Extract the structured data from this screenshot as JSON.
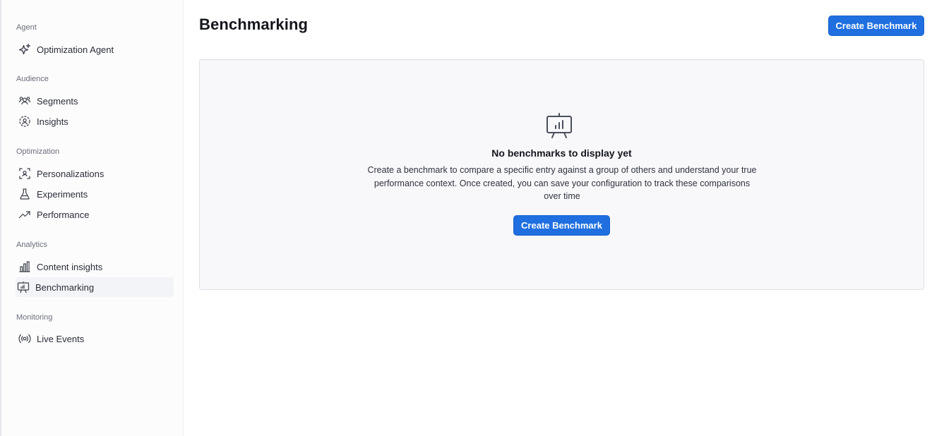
{
  "sidebar": {
    "sections": [
      {
        "label": "Agent",
        "items": [
          {
            "label": "Optimization Agent",
            "icon": "sparkle-icon"
          }
        ]
      },
      {
        "label": "Audience",
        "items": [
          {
            "label": "Segments",
            "icon": "users-icon"
          },
          {
            "label": "Insights",
            "icon": "user-focus-icon"
          }
        ]
      },
      {
        "label": "Optimization",
        "items": [
          {
            "label": "Personalizations",
            "icon": "user-scan-icon"
          },
          {
            "label": "Experiments",
            "icon": "flask-icon"
          },
          {
            "label": "Performance",
            "icon": "trend-up-icon"
          }
        ]
      },
      {
        "label": "Analytics",
        "items": [
          {
            "label": "Content insights",
            "icon": "bar-chart-icon"
          },
          {
            "label": "Benchmarking",
            "icon": "presentation-chart-icon",
            "active": true
          }
        ]
      },
      {
        "label": "Monitoring",
        "items": [
          {
            "label": "Live Events",
            "icon": "broadcast-icon"
          }
        ]
      }
    ]
  },
  "header": {
    "title": "Benchmarking",
    "create_button": "Create Benchmark"
  },
  "empty_state": {
    "icon": "presentation-chart-icon",
    "title": "No benchmarks to display yet",
    "description": "Create a benchmark to compare a specific entry against a group of others and understand your true performance context. Once created, you can save your configuration to track these comparisons over time",
    "button": "Create Benchmark"
  },
  "colors": {
    "primary": "#1f6fe0",
    "panel_bg": "#f8f8fb",
    "sidebar_bg": "#fcfcfd"
  }
}
